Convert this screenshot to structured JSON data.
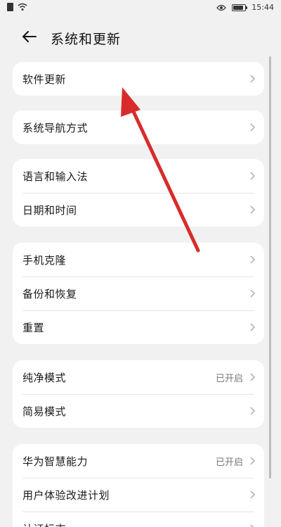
{
  "status_bar": {
    "time": "15:44",
    "battery_level": 0.9
  },
  "header": {
    "title": "系统和更新"
  },
  "groups": [
    {
      "items": [
        {
          "label": "软件更新",
          "value": ""
        }
      ]
    },
    {
      "items": [
        {
          "label": "系统导航方式",
          "value": ""
        }
      ]
    },
    {
      "items": [
        {
          "label": "语言和输入法",
          "value": ""
        },
        {
          "label": "日期和时间",
          "value": ""
        }
      ]
    },
    {
      "items": [
        {
          "label": "手机克隆",
          "value": ""
        },
        {
          "label": "备份和恢复",
          "value": ""
        },
        {
          "label": "重置",
          "value": ""
        }
      ]
    },
    {
      "items": [
        {
          "label": "纯净模式",
          "value": "已开启"
        },
        {
          "label": "简易模式",
          "value": ""
        }
      ]
    },
    {
      "items": [
        {
          "label": "华为智慧能力",
          "value": "已开启"
        },
        {
          "label": "用户体验改进计划",
          "value": ""
        },
        {
          "label": "认证标志",
          "value": ""
        }
      ]
    }
  ],
  "colors": {
    "annotation_arrow": "#d92b2b",
    "background": "#f1f1f1",
    "card": "#ffffff"
  }
}
